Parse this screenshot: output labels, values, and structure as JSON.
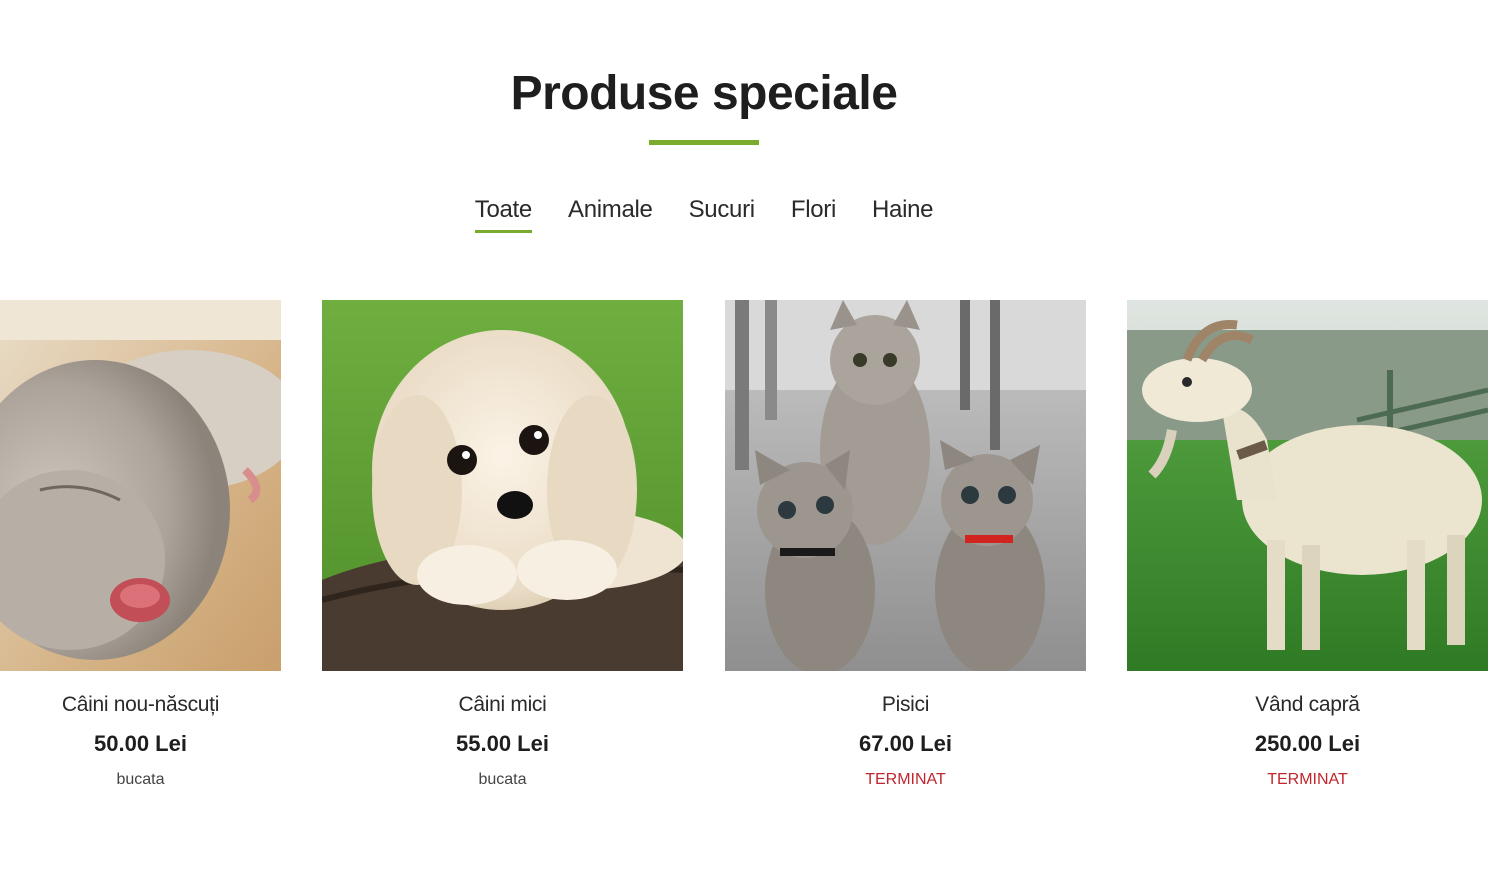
{
  "section": {
    "title": "Produse speciale"
  },
  "tabs": [
    {
      "label": "Toate",
      "active": true
    },
    {
      "label": "Animale",
      "active": false
    },
    {
      "label": "Sucuri",
      "active": false
    },
    {
      "label": "Flori",
      "active": false
    },
    {
      "label": "Haine",
      "active": false
    }
  ],
  "colors": {
    "accent": "#7aab2e",
    "out_of_stock": "#c0262d"
  },
  "products": [
    {
      "name": "Câini nou-născuți",
      "price": "50.00 Lei",
      "unit": "bucata",
      "image": "newborn-puppy-photo"
    },
    {
      "name": "Câini mici",
      "price": "55.00 Lei",
      "unit": "bucata",
      "image": "fluffy-puppy-photo"
    },
    {
      "name": "Pisici",
      "price": "67.00 Lei",
      "unit": "TERMINAT",
      "image": "kittens-photo"
    },
    {
      "name": "Vând capră",
      "price": "250.00 Lei",
      "unit": "TERMINAT",
      "image": "goat-photo"
    }
  ]
}
